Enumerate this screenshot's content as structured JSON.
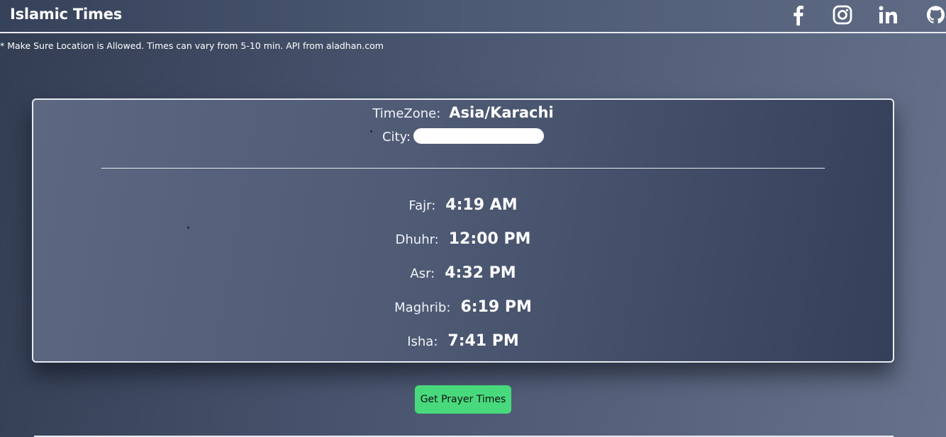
{
  "header": {
    "brand": "Islamic Times",
    "social_icons": [
      "facebook-icon",
      "instagram-icon",
      "linkedin-icon",
      "github-icon"
    ]
  },
  "notice": "* Make Sure Location is Allowed. Times can vary from 5-10 min. API from aladhan.com",
  "location": {
    "timezone_label": "TimeZone:",
    "timezone_value": "Asia/Karachi",
    "city_label": "City:"
  },
  "prayers": [
    {
      "label": "Fajr:",
      "time": "4:19 AM"
    },
    {
      "label": "Dhuhr:",
      "time": "12:00 PM"
    },
    {
      "label": "Asr:",
      "time": "4:32 PM"
    },
    {
      "label": "Maghrib:",
      "time": "6:19 PM"
    },
    {
      "label": "Isha:",
      "time": "7:41 PM"
    }
  ],
  "button": {
    "label": "Get Prayer Times"
  },
  "colors": {
    "accent_button": "#48d97d",
    "card_border": "#e7eaf0"
  }
}
